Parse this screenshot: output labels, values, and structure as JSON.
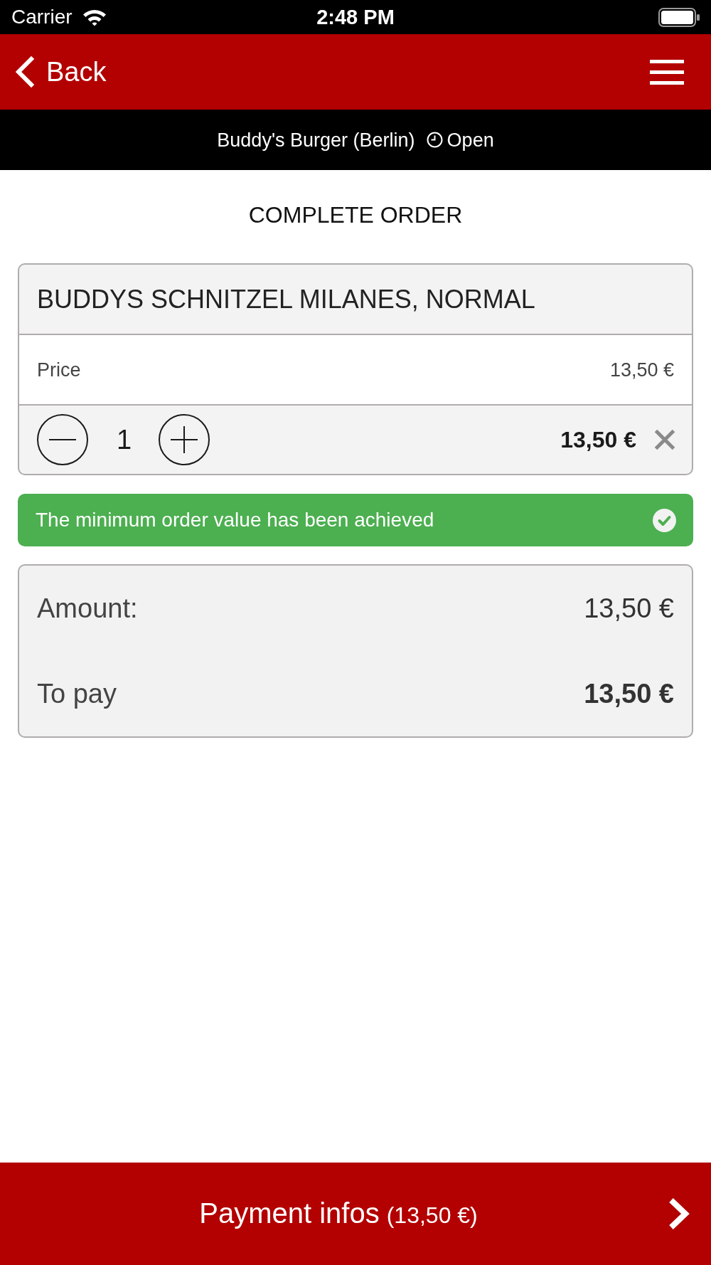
{
  "status_bar": {
    "carrier": "Carrier",
    "time": "2:48 PM"
  },
  "nav_bar": {
    "back_label": "Back"
  },
  "restaurant_bar": {
    "name": "Buddy's Burger (Berlin)",
    "status": "Open"
  },
  "page_title": "COMPLETE ORDER",
  "order_items": [
    {
      "name": "BUDDYS SCHNITZEL MILANES, NORMAL",
      "price_label": "Price",
      "price": "13,50 €",
      "quantity": "1",
      "total": "13,50 €"
    }
  ],
  "notice": {
    "text": "The minimum order value has been achieved",
    "achieved": true
  },
  "summary": [
    {
      "kind": "subtotal",
      "label": "Amount:",
      "value": "13,50 €"
    },
    {
      "kind": "total",
      "label": "To pay",
      "value": "13,50 €"
    }
  ],
  "footer_button": {
    "label": "Payment infos",
    "amount": "(13,50 €)"
  }
}
